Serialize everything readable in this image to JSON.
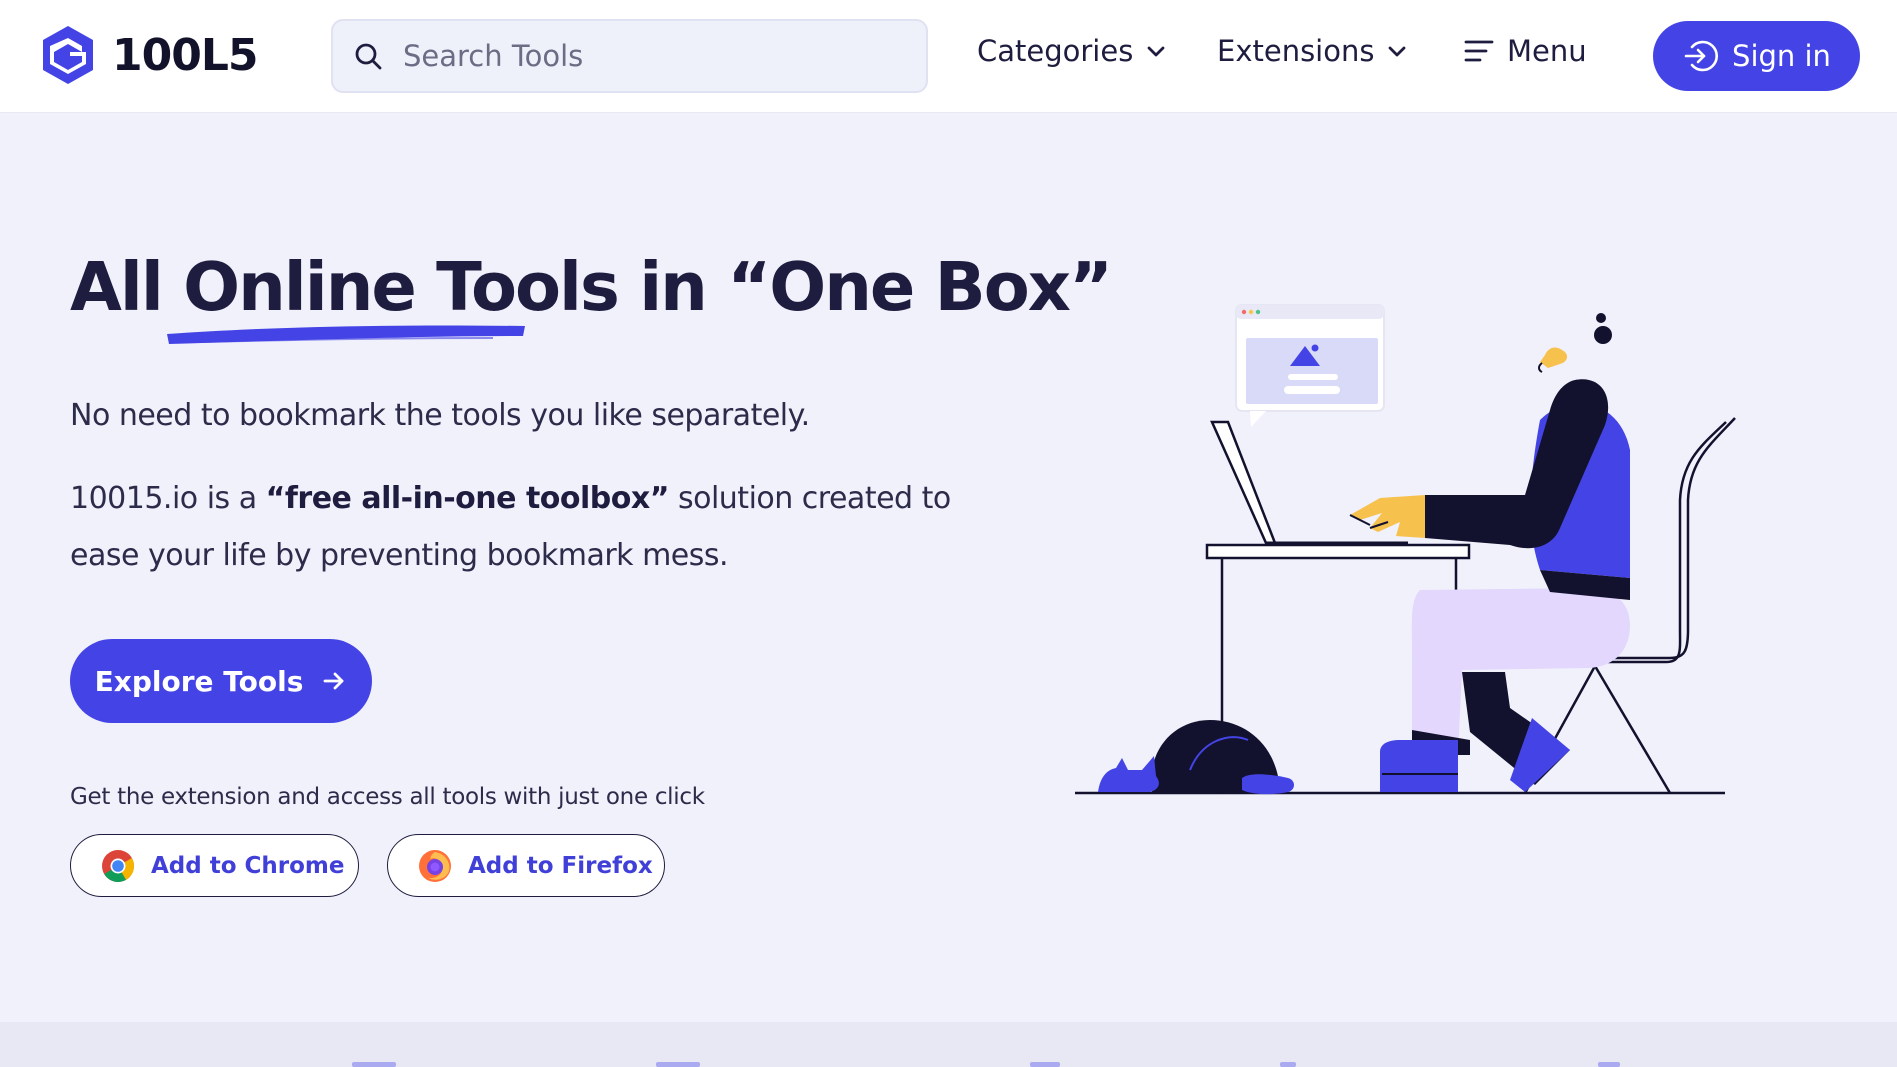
{
  "brand": {
    "name": "100L5",
    "accent": "#4444e6"
  },
  "header": {
    "search_placeholder": "Search Tools",
    "nav": {
      "categories": "Categories",
      "extensions": "Extensions",
      "menu": "Menu"
    },
    "sign_in": "Sign in"
  },
  "hero": {
    "title_part1": "All ",
    "title_highlight": "Online Tools",
    "title_part2": " in “One Box”",
    "subtitle": "No need to bookmark the tools you like separately.",
    "desc_part1": "10015.io is a ",
    "desc_strong": "“free all-in-one toolbox”",
    "desc_part2": " solution created to ease your life by preventing bookmark mess.",
    "cta": "Explore Tools"
  },
  "extensions": {
    "caption": "Get the extension and access all tools with just one click",
    "chrome": "Add to Chrome",
    "firefox": "Add to Firefox"
  },
  "icons": {
    "search": "search-icon",
    "chevron": "chevron-down-icon",
    "menu": "menu-icon",
    "signin": "sign-in-icon",
    "arrow": "arrow-right-icon",
    "chrome": "chrome-icon",
    "firefox": "firefox-icon"
  }
}
